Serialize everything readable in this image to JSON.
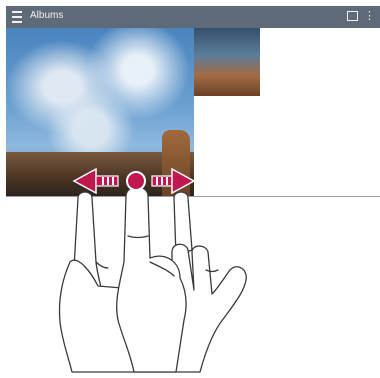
{
  "app_bar": {
    "title": "Albums",
    "menu_icon": "menu-icon",
    "actions": [
      "select-icon",
      "more-vert-icon"
    ]
  },
  "photos": {
    "large_caption": "",
    "small_caption": ""
  },
  "gesture": {
    "type": "swipe-horizontal",
    "arrow_color": "#c0184e",
    "touch_point_color": "#c0184e"
  },
  "colors": {
    "app_bar": "#5f6a78",
    "accent": "#c0184e"
  }
}
